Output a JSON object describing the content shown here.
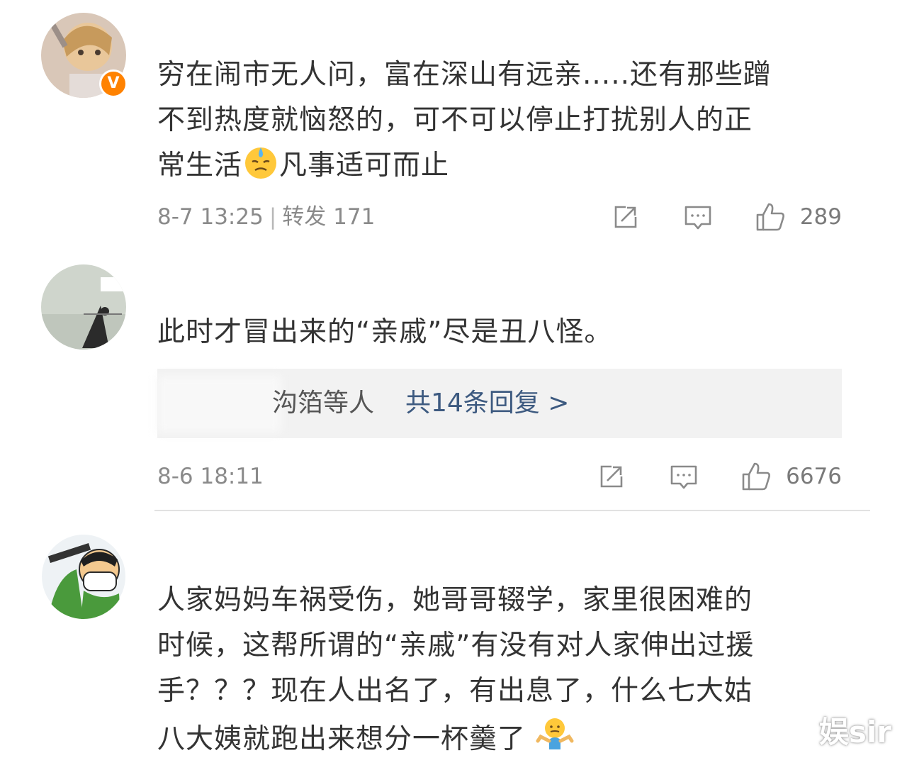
{
  "comments": [
    {
      "text_lines": [
        "穷在闹市无人问，富在深山有远亲.....还有那些蹭",
        "不到热度就恼怒的，可不可以停止打扰别人的正"
      ],
      "last_line_before": "常生活",
      "last_line_after": "凡事适可而止",
      "emoji": "sweat-face-emoji",
      "badge": "V",
      "timestamp": "8-7 13:25",
      "separator": "|",
      "repost_label": "转发 171",
      "like_count": "289"
    },
    {
      "text": "此时才冒出来的“亲戚”尽是丑八怪。",
      "reply_names": "沟箔等人",
      "reply_link": "共14条回复 >",
      "timestamp": "8-6 18:11",
      "like_count": "6676"
    },
    {
      "text_lines": [
        "人家妈妈车祸受伤，她哥哥辍学，家里很困难的",
        "时候，这帮所谓的“亲戚”有没有对人家伸出过援",
        "手？？？现在人出名了，有出息了，什么七大姑"
      ],
      "last_line_before": "八大姨就跑出来想分一杯羹了",
      "emoji": "shrug-emoji"
    }
  ],
  "watermark": "娱sir",
  "icons": [
    "share-icon",
    "comment-icon",
    "like-icon"
  ],
  "colors": {
    "badge": "#ff8200",
    "reply_link": "#3d5a80",
    "meta": "#8a8a8a"
  }
}
